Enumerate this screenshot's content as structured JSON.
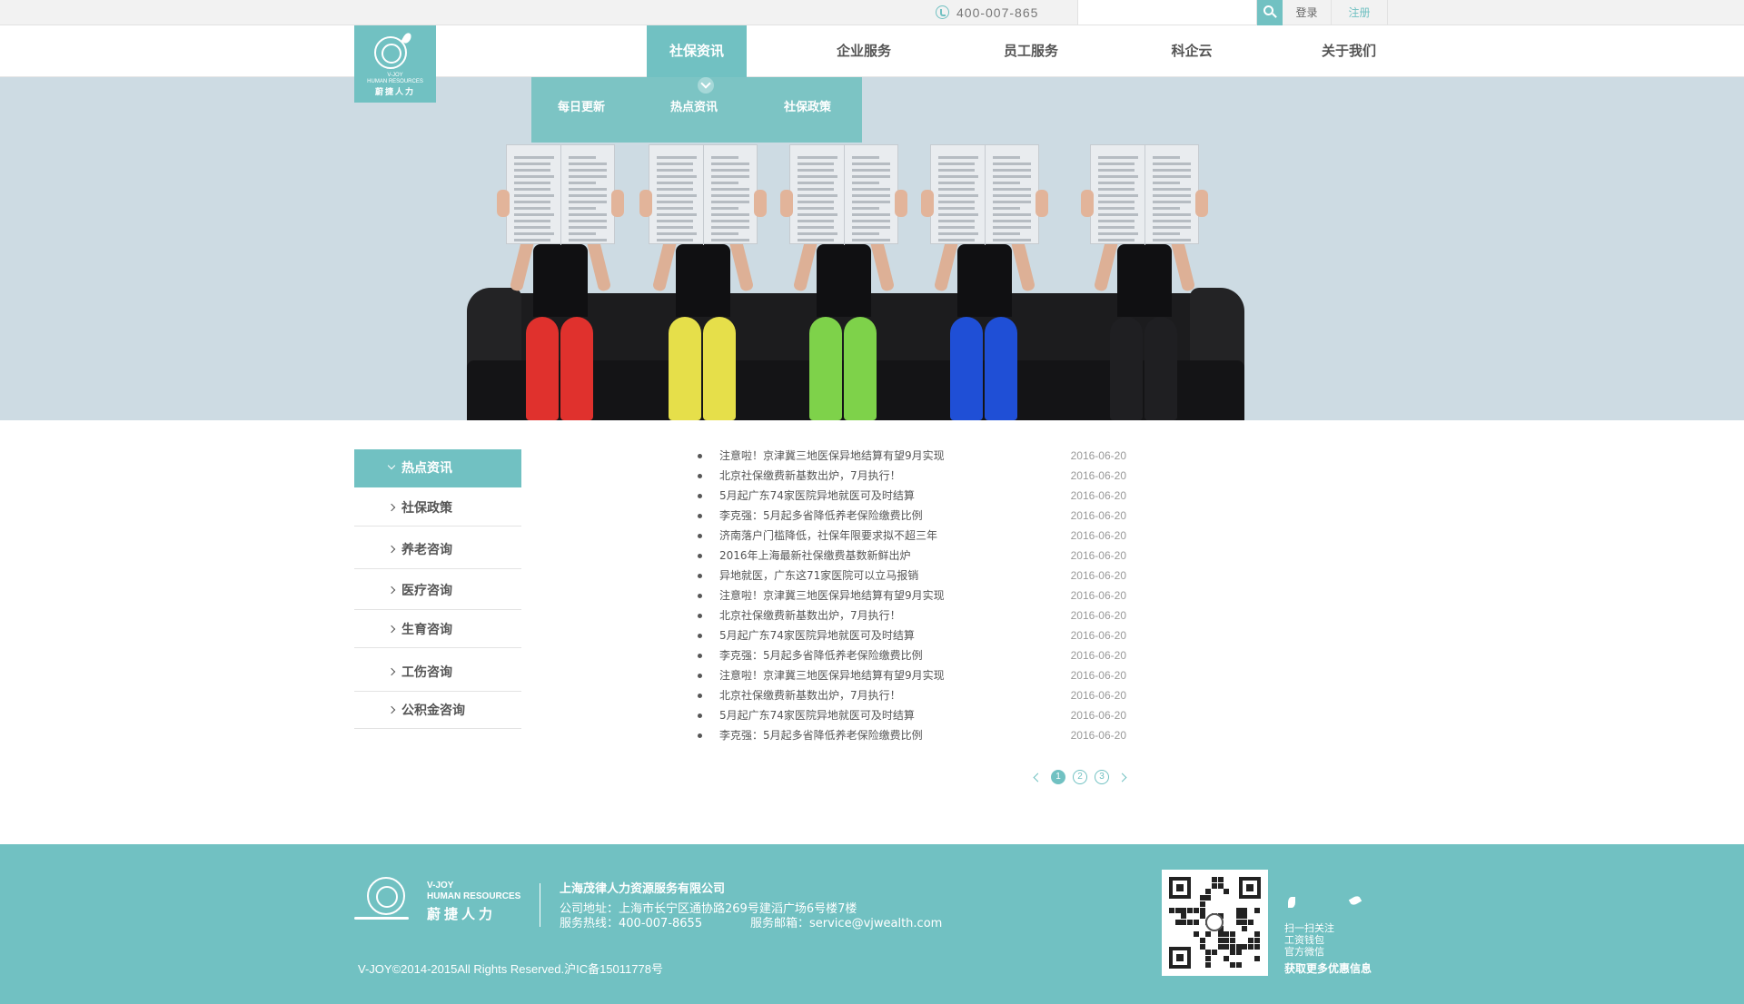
{
  "topbar": {
    "phone": "400-007-865",
    "search_placeholder": "",
    "login_label": "登录",
    "register_label": "注册"
  },
  "brand": {
    "name_en_1": "V-JOY",
    "name_en_2": "HUMAN RESOURCES",
    "name_cn": "蔚捷人力"
  },
  "nav": [
    {
      "label": "社保资讯",
      "active": true
    },
    {
      "label": "企业服务",
      "active": false
    },
    {
      "label": "员工服务",
      "active": false
    },
    {
      "label": "科企云",
      "active": false
    },
    {
      "label": "关于我们",
      "active": false
    }
  ],
  "subnav": [
    "每日更新",
    "热点资讯",
    "社保政策"
  ],
  "banner": {
    "leg_colors": [
      "#e0312d",
      "#e6df4a",
      "#7ed24a",
      "#1f4fd6",
      "#1f1f22"
    ]
  },
  "sidebar": [
    {
      "label": "热点资讯",
      "active": true
    },
    {
      "label": "社保政策",
      "active": false
    },
    {
      "label": "养老咨询",
      "active": false
    },
    {
      "label": "医疗咨询",
      "active": false
    },
    {
      "label": "生育咨询",
      "active": false
    },
    {
      "label": "工伤咨询",
      "active": false
    },
    {
      "label": "公积金咨询",
      "active": false
    }
  ],
  "articles": [
    {
      "title": "注意啦！京津冀三地医保异地结算有望9月实现",
      "date": "2016-06-20"
    },
    {
      "title": "北京社保缴费新基数出炉，7月执行！",
      "date": "2016-06-20"
    },
    {
      "title": "5月起广东74家医院异地就医可及时结算",
      "date": "2016-06-20"
    },
    {
      "title": "李克强：5月起多省降低养老保险缴费比例",
      "date": "2016-06-20"
    },
    {
      "title": "济南落户门槛降低，社保年限要求拟不超三年",
      "date": "2016-06-20"
    },
    {
      "title": "2016年上海最新社保缴费基数新鲜出炉",
      "date": "2016-06-20"
    },
    {
      "title": "异地就医，广东这71家医院可以立马报销",
      "date": "2016-06-20"
    },
    {
      "title": "注意啦！京津冀三地医保异地结算有望9月实现",
      "date": "2016-06-20"
    },
    {
      "title": "北京社保缴费新基数出炉，7月执行！",
      "date": "2016-06-20"
    },
    {
      "title": "5月起广东74家医院异地就医可及时结算",
      "date": "2016-06-20"
    },
    {
      "title": "李克强：5月起多省降低养老保险缴费比例",
      "date": "2016-06-20"
    },
    {
      "title": "注意啦！京津冀三地医保异地结算有望9月实现",
      "date": "2016-06-20"
    },
    {
      "title": "北京社保缴费新基数出炉，7月执行！",
      "date": "2016-06-20"
    },
    {
      "title": "5月起广东74家医院异地就医可及时结算",
      "date": "2016-06-20"
    },
    {
      "title": "李克强：5月起多省降低养老保险缴费比例",
      "date": "2016-06-20"
    }
  ],
  "pagination": {
    "pages": [
      "1",
      "2",
      "3"
    ],
    "current": "1"
  },
  "footer": {
    "company": "上海茂律人力资源服务有限公司",
    "address": "公司地址：上海市长宁区通协路269号建滔广场6号楼7楼",
    "hotline": "服务热线：400-007-8655",
    "email": "服务邮箱：service@vjwealth.com",
    "copyright": "V-JOY©2014-2015All Rights Reserved.沪IC备15011778号",
    "scan_lines": [
      "扫一扫关注",
      "工资钱包",
      "官方微信"
    ],
    "get_more": "获取更多优惠信息"
  },
  "colors": {
    "accent": "#71c1c2",
    "banner_bg": "#cddbe3"
  }
}
